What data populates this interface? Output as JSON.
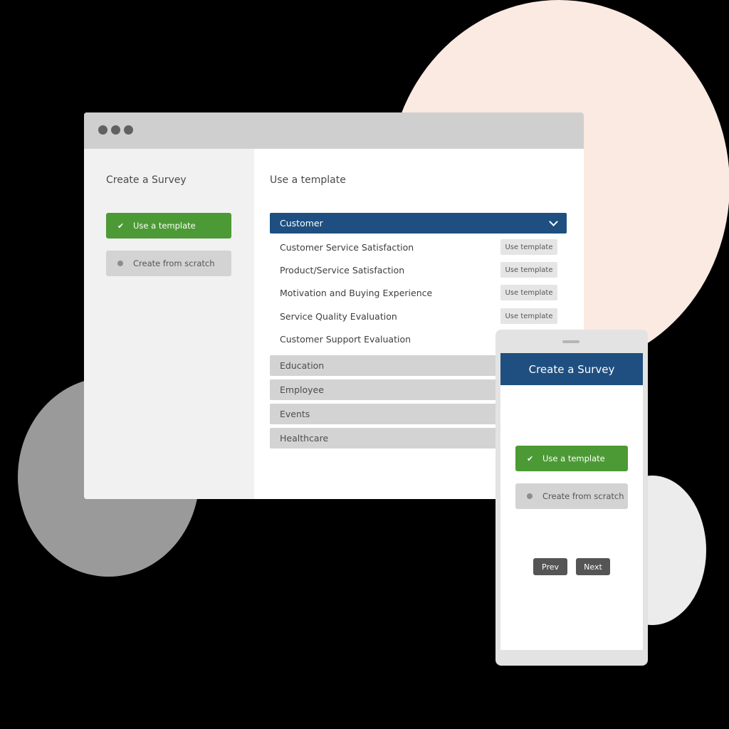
{
  "colors": {
    "accent_green": "#4c9a35",
    "header_blue": "#1e4f80",
    "background": "#000000"
  },
  "desktop": {
    "sidebar": {
      "title": "Create a Survey",
      "options": [
        {
          "label": "Use a template",
          "icon": "check-icon",
          "selected": true
        },
        {
          "label": "Create from scratch",
          "icon": "dot-icon",
          "selected": false
        }
      ]
    },
    "main": {
      "title": "Use a template",
      "expanded_category": "Customer",
      "templates": [
        {
          "name": "Customer Service Satisfaction",
          "action": "Use template"
        },
        {
          "name": "Product/Service Satisfaction",
          "action": "Use template"
        },
        {
          "name": "Motivation and Buying Experience",
          "action": "Use template"
        },
        {
          "name": "Service Quality Evaluation",
          "action": "Use template"
        },
        {
          "name": "Customer Support Evaluation"
        }
      ],
      "categories": [
        "Education",
        "Employee",
        "Events",
        "Healthcare"
      ]
    }
  },
  "mobile": {
    "header": "Create a Survey",
    "options": [
      {
        "label": "Use a template",
        "icon": "check-icon",
        "selected": true
      },
      {
        "label": "Create from scratch",
        "icon": "dot-icon",
        "selected": false
      }
    ],
    "prev_label": "Prev",
    "next_label": "Next"
  }
}
